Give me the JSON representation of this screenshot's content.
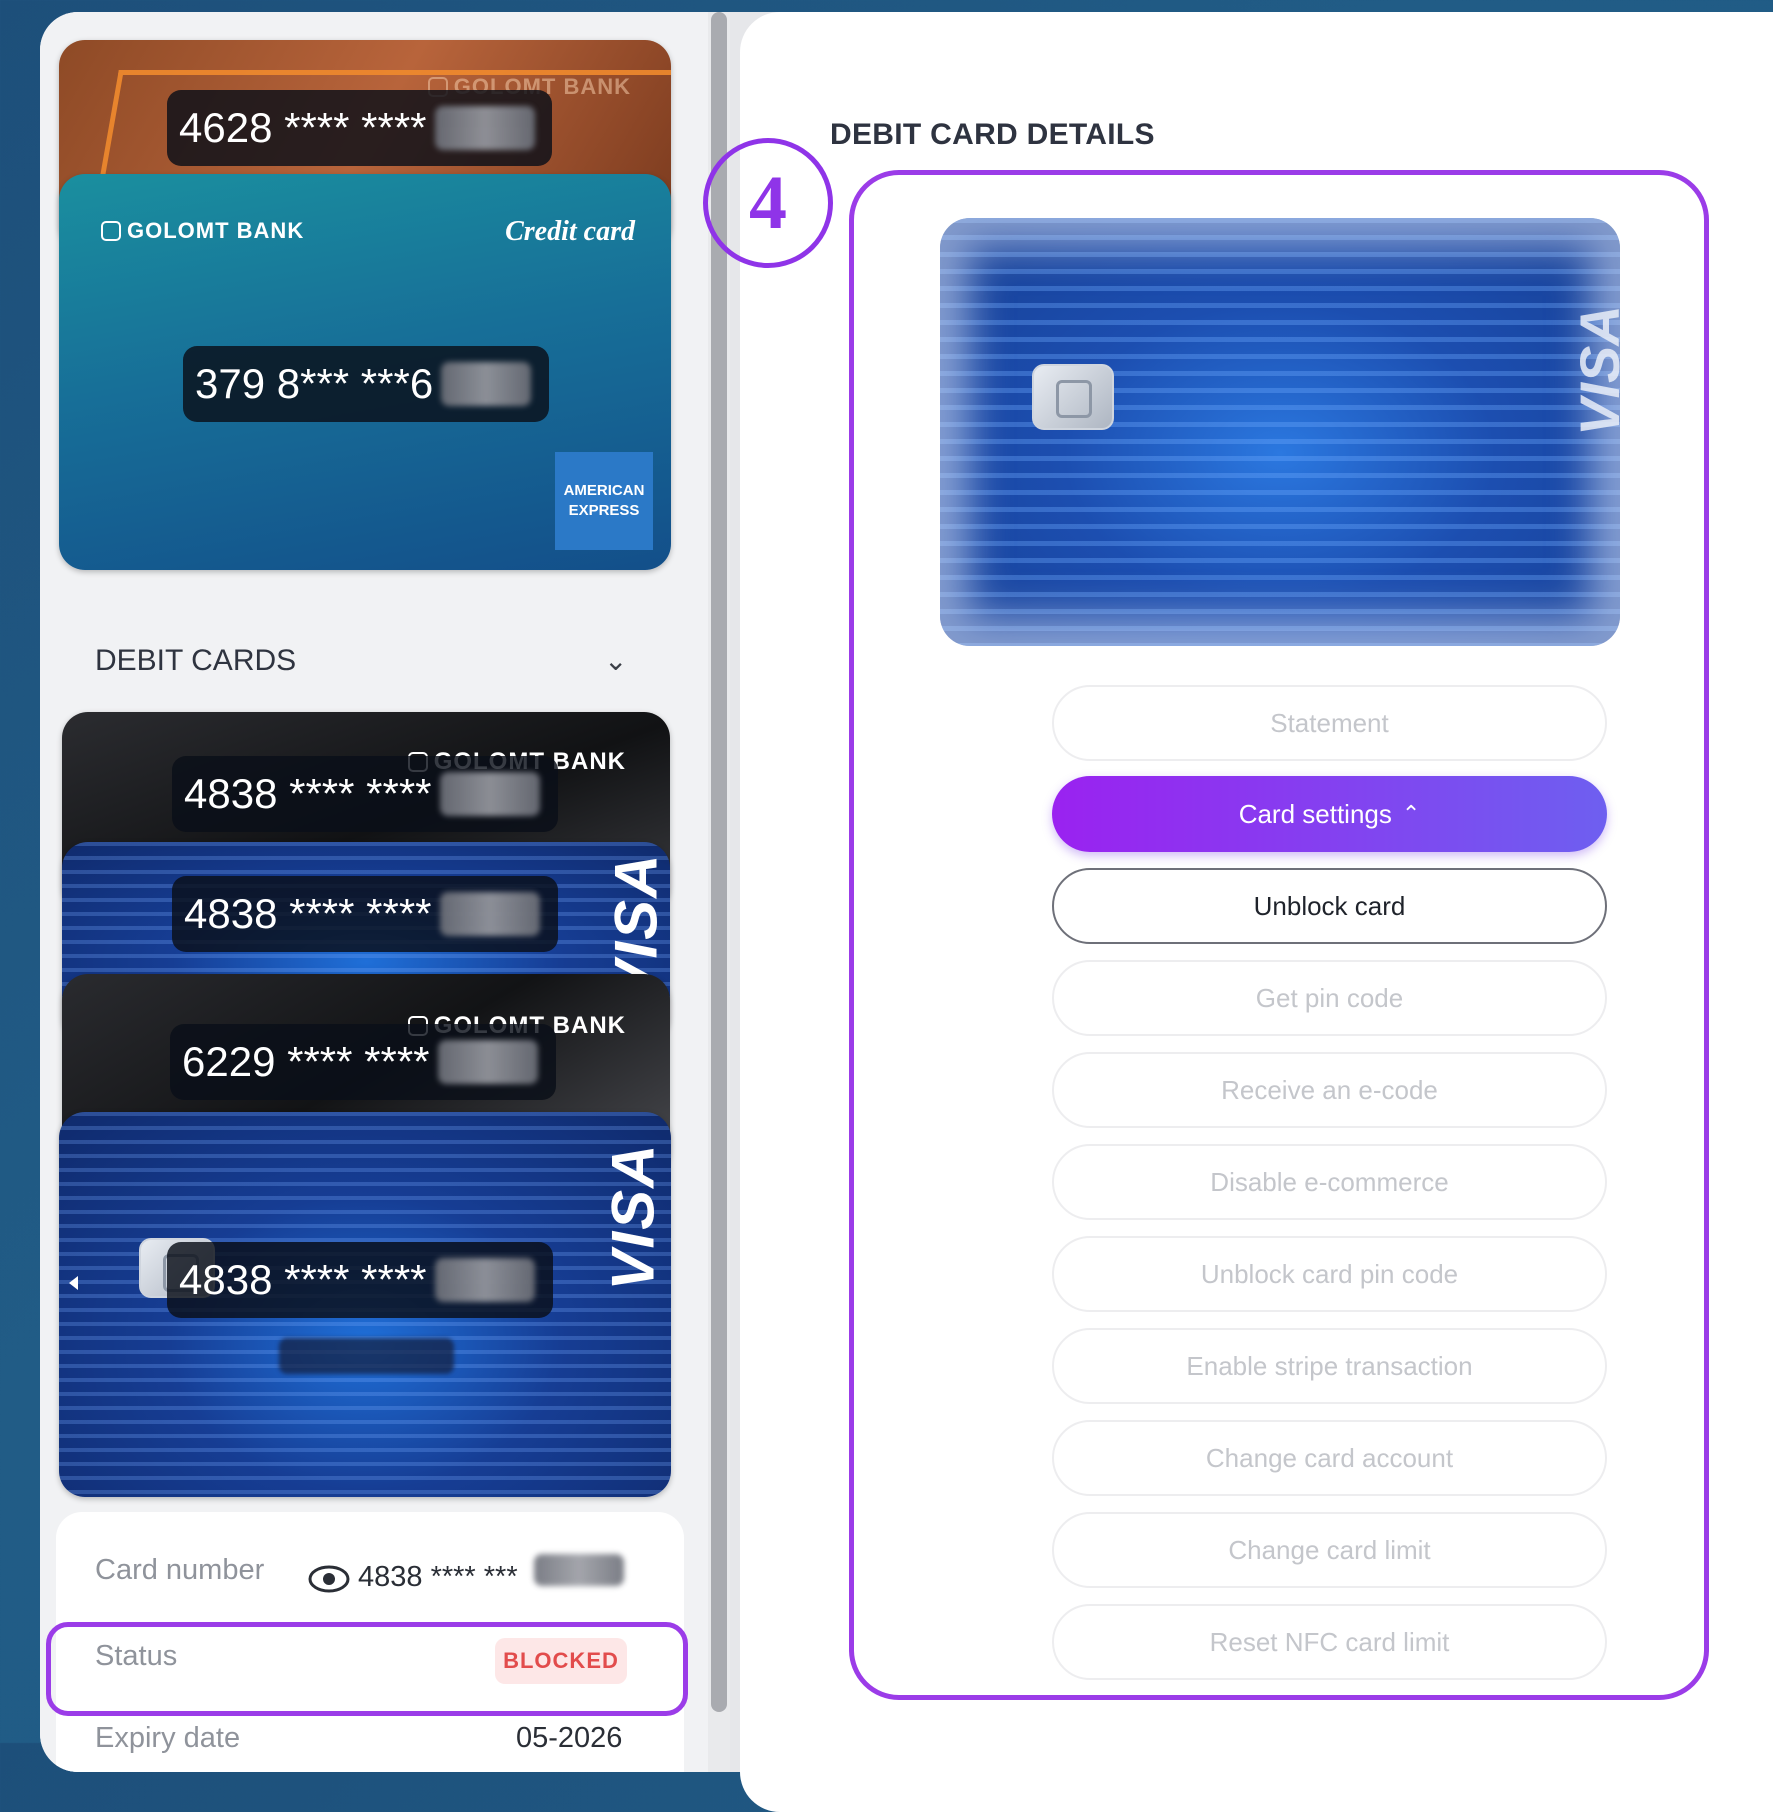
{
  "credit_cards": [
    {
      "number": "4628 **** ****",
      "bank": "GOLOMT BANK"
    },
    {
      "number": "379 8*** ***6",
      "bank": "GOLOMT BANK",
      "label": "Credit card",
      "network": "AMERICAN EXPRESS"
    }
  ],
  "debit_section": {
    "title": "DEBIT CARDS"
  },
  "debit_cards": [
    {
      "number": "4838 **** ****",
      "bank": "GOLOMT BANK"
    },
    {
      "number": "4838 **** ****",
      "network": "VISA"
    },
    {
      "number": "6229 **** ****",
      "bank": "GOLOMT BANK"
    },
    {
      "number": "4838 **** ****",
      "network": "VISA"
    }
  ],
  "details": {
    "card_number_label": "Card number",
    "card_number_value": "4838 **** ***",
    "status_label": "Status",
    "status_value": "BLOCKED",
    "expiry_label": "Expiry date",
    "expiry_value": "05-2026"
  },
  "right_panel": {
    "title": "DEBIT CARD DETAILS",
    "step_number": "4",
    "card_network": "VISA",
    "buttons": [
      "Statement",
      "Card settings",
      "Unblock card",
      "Get pin code",
      "Receive an e-code",
      "Disable e-commerce",
      "Unblock card pin code",
      "Enable stripe transaction",
      "Change card account",
      "Change card limit",
      "Reset NFC card limit"
    ]
  },
  "colors": {
    "accent": "#9b3ce8",
    "blocked": "#e24c4c",
    "background": "#1f5a84"
  }
}
